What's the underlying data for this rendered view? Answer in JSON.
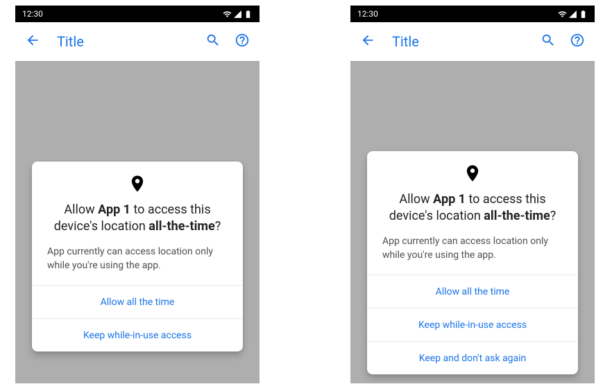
{
  "status": {
    "time": "12:30"
  },
  "appbar": {
    "title": "Title"
  },
  "left_dialog": {
    "headline_pre": "Allow ",
    "headline_app": "App 1",
    "headline_mid": " to access this device's location ",
    "headline_bold": "all-the-time",
    "headline_post": "?",
    "body": "App currently can access location only while you're using the app.",
    "options": {
      "allow": "Allow all the time",
      "keep": "Keep while-in-use access"
    }
  },
  "right_dialog": {
    "headline_pre": "Allow ",
    "headline_app": "App 1",
    "headline_mid": " to access this device's location ",
    "headline_bold": "all-the-time",
    "headline_post": "?",
    "body": "App currently can access location only while you're using the app.",
    "options": {
      "allow": "Allow all the time",
      "keep": "Keep while-in-use access",
      "deny": "Keep and don't ask again"
    }
  }
}
